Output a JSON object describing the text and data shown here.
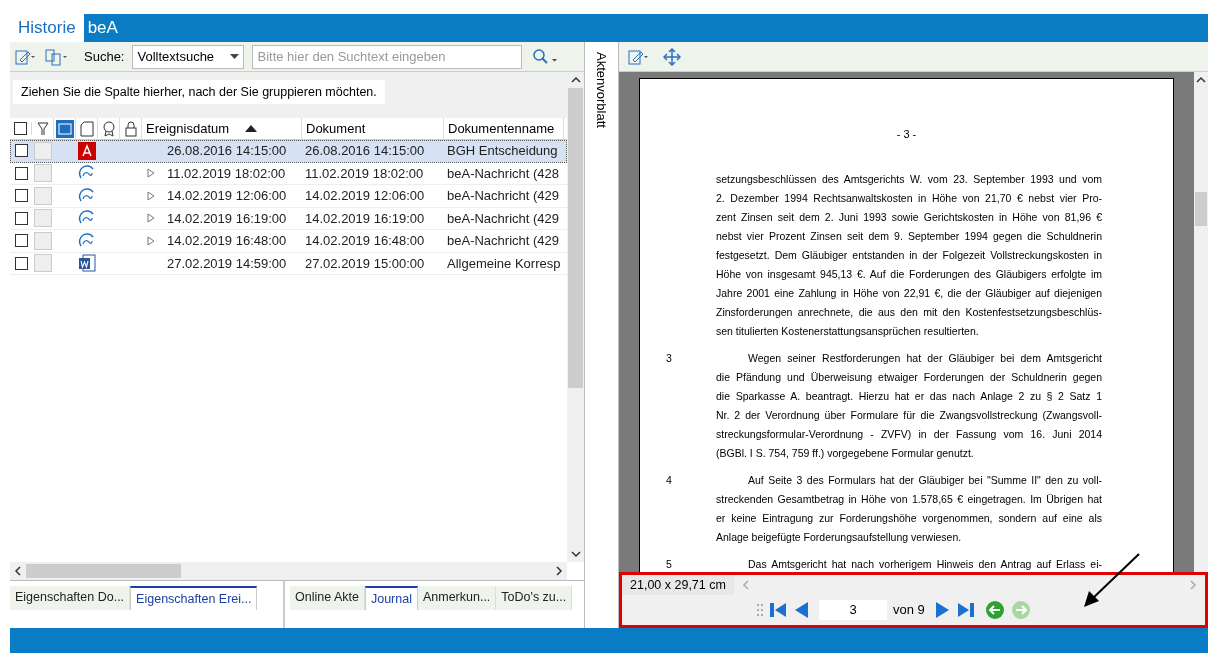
{
  "tabs": [
    {
      "label": "Historie",
      "selected": true
    },
    {
      "label": "beA",
      "selected": false
    }
  ],
  "toolbar": {
    "search_label": "Suche:",
    "search_mode": "Volltextsuche",
    "search_field": {
      "placeholder": "Bitte hier den Suchtext eingeben"
    }
  },
  "group_hint": "Ziehen Sie die Spalte hierher, nach der Sie gruppieren möchten.",
  "table": {
    "all_checked": false,
    "columns": [
      "Ereignisdatum",
      "Dokument",
      "Dokumentenname"
    ],
    "sort_ascending": true,
    "rows": [
      {
        "selected": true,
        "checked": false,
        "kind": "pdf",
        "expandable": false,
        "cells": [
          "26.08.2016 14:15:00",
          "26.08.2016 14:15:00",
          "BGH Entscheidung"
        ]
      },
      {
        "selected": false,
        "checked": false,
        "kind": "bea",
        "expandable": true,
        "cells": [
          "11.02.2019 18:02:00",
          "11.02.2019 18:02:00",
          "beA-Nachricht (428"
        ]
      },
      {
        "selected": false,
        "checked": false,
        "kind": "bea",
        "expandable": true,
        "cells": [
          "14.02.2019 12:06:00",
          "14.02.2019 12:06:00",
          "beA-Nachricht (429"
        ]
      },
      {
        "selected": false,
        "checked": false,
        "kind": "bea",
        "expandable": true,
        "cells": [
          "14.02.2019 16:19:00",
          "14.02.2019 16:19:00",
          "beA-Nachricht (429"
        ]
      },
      {
        "selected": false,
        "checked": false,
        "kind": "bea",
        "expandable": true,
        "cells": [
          "14.02.2019 16:48:00",
          "14.02.2019 16:48:00",
          "beA-Nachricht (429"
        ]
      },
      {
        "selected": false,
        "checked": false,
        "kind": "word",
        "expandable": false,
        "cells": [
          "27.02.2019 14:59:00",
          "27.02.2019 15:00:00",
          "Allgemeine Korresp"
        ]
      }
    ]
  },
  "side_label": "Aktenvorblatt",
  "bottom_tabs_left": [
    {
      "label": "Eigenschaften Do...",
      "selected": false
    },
    {
      "label": "Eigenschaften Erei...",
      "selected": true
    }
  ],
  "bottom_tabs_right": [
    {
      "label": "Online Akte",
      "selected": false
    },
    {
      "label": "Journal",
      "selected": true
    },
    {
      "label": "Anmerkun...",
      "selected": false
    },
    {
      "label": "ToDo's zu...",
      "selected": false
    }
  ],
  "document": {
    "page_header": "- 3 -",
    "paragraphs": [
      {
        "lines": [
          "setzungsbeschlüssen des Amtsgerichts W. vom 23. September 1993 und vom",
          "2. Dezember 1994 Rechtsanwaltskosten in Höhe von 21,70 € nebst vier Pro-",
          "zent Zinsen seit dem 2. Juni 1993 sowie Gerichtskosten in Höhe von 81,96 €",
          "nebst vier Prozent Zinsen seit dem 9. September 1994 gegen die Schuldnerin",
          "festgesetzt. Dem Gläubiger entstanden in der Folgezeit Vollstreckungskosten in",
          "Höhe von insgesamt 945,13 €. Auf die Forderungen des Gläubigers erfolgte im",
          "Jahre 2001 eine Zahlung in Höhe von 22,91 €, die der Gläubiger auf diejenigen",
          "Zinsforderungen anrechnete, die aus den mit den Kostenfestsetzungsbeschlüs-",
          "sen titulierten Kostenerstattungsansprüchen resultierten."
        ]
      },
      {
        "number": "3",
        "lines": [
          "Wegen seiner Restforderungen hat der Gläubiger bei dem Amtsgericht",
          "die Pfändung und Überweisung etwaiger Forderungen der Schuldnerin gegen",
          "die Sparkasse A. beantragt. Hierzu hat er das nach Anlage 2 zu § 2 Satz 1",
          "Nr. 2 der Verordnung über Formulare für die Zwangsvollstreckung (Zwangsvoll-",
          "streckungsformular-Verordnung - ZVFV) in der Fassung vom 16. Juni 2014",
          "(BGBl. I S. 754, 759 ff.) vorgegebene Formular genutzt."
        ]
      },
      {
        "number": "4",
        "lines": [
          "Auf Seite 3 des Formulars hat der Gläubiger bei \"Summe II\" den zu voll-",
          "streckenden Gesamtbetrag in Höhe von 1.578,65 € eingetragen. Im Übrigen hat",
          "er keine Eintragung zur Forderungshöhe vorgenommen, sondern auf eine als",
          "Anlage beigefügte Forderungsaufstellung verwiesen."
        ]
      },
      {
        "number": "5",
        "lines": [
          "Das Amtsgericht hat nach vorherigem Hinweis den Antrag auf Erlass ei-"
        ]
      }
    ]
  },
  "page_size": "21,00 x 29,71 cm",
  "pager": {
    "current": "3",
    "total": "von 9",
    "back_enabled": true,
    "forward_enabled": false
  }
}
